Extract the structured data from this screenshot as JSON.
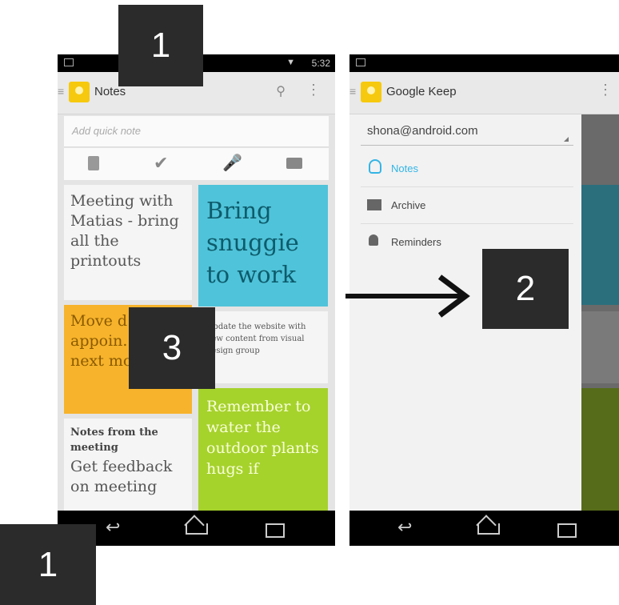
{
  "left_phone": {
    "status_time": "5:32",
    "app_title": "Notes",
    "quick_note_placeholder": "Add quick note",
    "icons": [
      "note-icon",
      "checkmark-icon",
      "microphone-icon",
      "camera-icon"
    ],
    "notes": [
      {
        "text": "Meeting with Matias - bring all the printouts",
        "color": "#f5f5f5"
      },
      {
        "text": "Bring snuggie to work",
        "color": "#4fc3d9"
      },
      {
        "text": "Move d... appoin... to next month",
        "color": "#f7b32b"
      },
      {
        "text": "Update the website with new content from visual design group",
        "color": "#f5f5f5"
      },
      {
        "title": "Notes from the meeting",
        "text": "Get feedback on meeting",
        "color": "#f5f5f5"
      },
      {
        "text": "Remember to water the outdoor plants hugs if",
        "color": "#a6d22c"
      }
    ]
  },
  "right_phone": {
    "app_title": "Google Keep",
    "account": "shona@android.com",
    "drawer_items": [
      {
        "label": "Notes",
        "icon": "lightbulb-icon",
        "active": true
      },
      {
        "label": "Archive",
        "icon": "archive-icon",
        "active": false
      },
      {
        "label": "Reminders",
        "icon": "bell-icon",
        "active": false
      }
    ]
  },
  "callouts": {
    "label_1_top": "1",
    "label_2": "2",
    "label_3": "3",
    "label_1_bottom": "1"
  },
  "colors": {
    "accent_blue": "#33b5e5",
    "callout_bg": "#2b2b2b"
  }
}
